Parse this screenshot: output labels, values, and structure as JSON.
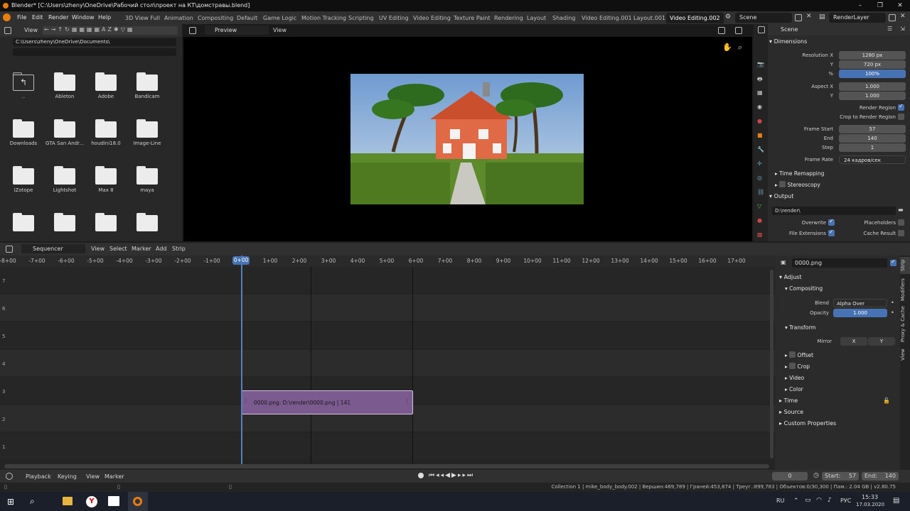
{
  "window": {
    "title": "Blender* [C:\\Users\\zheny\\OneDrive\\Рабочий стол\\проект на КТ\\домстравы.blend]",
    "controls": [
      "–",
      "❐",
      "✕"
    ]
  },
  "menu": {
    "items": [
      "File",
      "Edit",
      "Render",
      "Window",
      "Help"
    ],
    "workspaces": [
      "3D View Full",
      "Animation",
      "Compositing",
      "Default",
      "Game Logic",
      "Motion Tracking",
      "Scripting",
      "UV Editing",
      "Video Editing",
      "Texture Paint",
      "Rendering",
      "Layout",
      "Shading",
      "Video Editing.001",
      "Layout.001",
      "Video Editing.002"
    ],
    "active_workspace": "Video Editing.002",
    "scene": "Scene",
    "view_layer": "RenderLayer"
  },
  "file_browser": {
    "view_label": "View",
    "path": "C:\\Users\\zheny\\OneDrive\\Documents\\",
    "items": [
      {
        "label": "..",
        "icon": "parent-folder-icon"
      },
      {
        "label": "Ableton",
        "icon": "folder-icon"
      },
      {
        "label": "Adobe",
        "icon": "folder-icon"
      },
      {
        "label": "Bandicam",
        "icon": "folder-icon"
      },
      {
        "label": "Downloads",
        "icon": "folder-icon"
      },
      {
        "label": "GTA San Andr...",
        "icon": "folder-icon"
      },
      {
        "label": "houdini18.0",
        "icon": "folder-icon"
      },
      {
        "label": "Image-Line",
        "icon": "folder-icon"
      },
      {
        "label": "iZotope",
        "icon": "folder-icon"
      },
      {
        "label": "Lightshot",
        "icon": "folder-icon"
      },
      {
        "label": "Max 8",
        "icon": "folder-icon"
      },
      {
        "label": "maya",
        "icon": "folder-icon"
      },
      {
        "label": "",
        "icon": "folder-icon"
      },
      {
        "label": "",
        "icon": "folder-icon"
      },
      {
        "label": "",
        "icon": "folder-icon"
      },
      {
        "label": "",
        "icon": "folder-icon"
      }
    ]
  },
  "preview": {
    "mode": "Preview",
    "view_label": "View"
  },
  "properties": {
    "scene_label": "Scene",
    "dimensions_title": "Dimensions",
    "resolution_x_label": "Resolution X",
    "resolution_x": "1280 px",
    "y_label": "Y",
    "resolution_y": "720 px",
    "percent_label": "%",
    "percent": "100%",
    "aspect_x_label": "Aspect X",
    "aspect_x": "1.000",
    "aspect_y": "1.000",
    "render_region": "Render Region",
    "crop_region": "Crop to Render Region",
    "frame_start_label": "Frame Start",
    "frame_start": "57",
    "end_label": "End",
    "frame_end": "140",
    "step_label": "Step",
    "frame_step": "1",
    "frame_rate_label": "Frame Rate",
    "frame_rate": "24 кадров/сек",
    "time_remapping": "Time Remapping",
    "stereoscopy": "Stereoscopy",
    "output_title": "Output",
    "output_path": "D:\\render\\",
    "overwrite": "Overwrite",
    "placeholders": "Placeholders",
    "file_extensions": "File Extensions",
    "cache_result": "Cache Result"
  },
  "sequencer": {
    "editor": "Sequencer",
    "menus": [
      "View",
      "Select",
      "Marker",
      "Add",
      "Strip"
    ],
    "ruler_labels": [
      "-8+00",
      "-7+00",
      "-6+00",
      "-5+00",
      "-4+00",
      "-3+00",
      "-2+00",
      "-1+00",
      "0+00",
      "1+00",
      "2+00",
      "3+00",
      "4+00",
      "5+00",
      "6+00",
      "7+00",
      "8+00",
      "9+00",
      "10+00",
      "11+00",
      "12+00",
      "13+00",
      "14+00",
      "15+00",
      "16+00",
      "17+00"
    ],
    "current_frame_label": "0+00",
    "channels": [
      "7",
      "6",
      "5",
      "4",
      "3",
      "2",
      "1"
    ],
    "strip_label": "0000.png: D:\\render\\0000.png | 141",
    "strip_color": "#7a5a8f"
  },
  "strip_props": {
    "name": "0000.png",
    "adjust": "Adjust",
    "compositing": "Compositing",
    "blend_label": "Blend",
    "blend_value": "Alpha Over",
    "opacity_label": "Opacity",
    "opacity_value": "1.000",
    "transform": "Transform",
    "mirror_label": "Mirror",
    "mirror_x": "X",
    "mirror_y": "Y",
    "offset": "Offset",
    "crop": "Crop",
    "video": "Video",
    "color": "Color",
    "time": "Time",
    "source": "Source",
    "custom_props": "Custom Properties",
    "tabs": [
      "Strip",
      "Modifiers",
      "Proxy & Cache",
      "View"
    ]
  },
  "timeline": {
    "menus": [
      "Playback",
      "Keying",
      "View",
      "Marker"
    ],
    "current_frame": "0",
    "start_label": "Start:",
    "start": "57",
    "end_label": "End:",
    "end": "140"
  },
  "status": {
    "text": "Collection 1 | mike_body_body.002 | Вершин:469,789 | Граней:453,874 | Треуг.:899,783 | Объектов:0/30,300 | Пам.: 2.04 GB | v2.80.75"
  },
  "taskbar": {
    "lang": "RU",
    "lang2": "РУС",
    "time": "15:33",
    "date": "17.03.2020"
  },
  "colors": {
    "accent": "#4772b3",
    "playhead": "#5680c2",
    "bg": "#1d1d1d",
    "header": "#303030"
  }
}
